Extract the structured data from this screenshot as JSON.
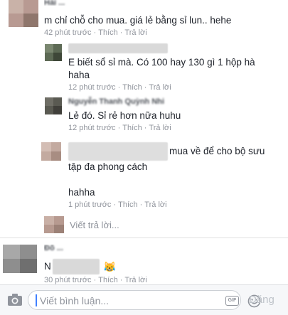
{
  "comments": [
    {
      "name": "Hải ...",
      "text": "m chỉ chỗ cho mua. giá lẻ bằng sỉ lun.. hehe",
      "time": "42 phút trước",
      "like": "Thích",
      "reply": "Trả lời"
    },
    {
      "name": "",
      "text_line1": "E biết sổ sỉ mà. Có 100 hay 130 gì 1 hộp hà",
      "text_line2": "haha",
      "time": "12 phút trước",
      "like": "Thích",
      "reply": "Trả lời"
    },
    {
      "name": "Nguyễn Thanh Quỳnh Nhi",
      "text": "Lẻ đó. Sỉ rẻ hơn nữa huhu",
      "time": "12 phút trước",
      "like": "Thích",
      "reply": "Trả lời"
    },
    {
      "name": "",
      "text_line1": "mua về để cho bộ sưu",
      "text_line2": "tập đa phong cách",
      "text_line3": "hahha",
      "time": "1 phút trước",
      "like": "Thích",
      "reply": "Trả lời"
    },
    {
      "name": "Đỗ ...",
      "text_prefix": "N",
      "emoji": "😹",
      "time": "30 phút trước",
      "like": "Thích",
      "reply": "Trả lời"
    }
  ],
  "reply_prompt": "Viết trả lời...",
  "composer": {
    "placeholder": "Viết bình luận...",
    "gif_label": "GIF",
    "send_label": "Đăng"
  },
  "icons": {
    "camera": "camera-icon",
    "gif": "gif-icon",
    "smile": "smile-icon"
  }
}
